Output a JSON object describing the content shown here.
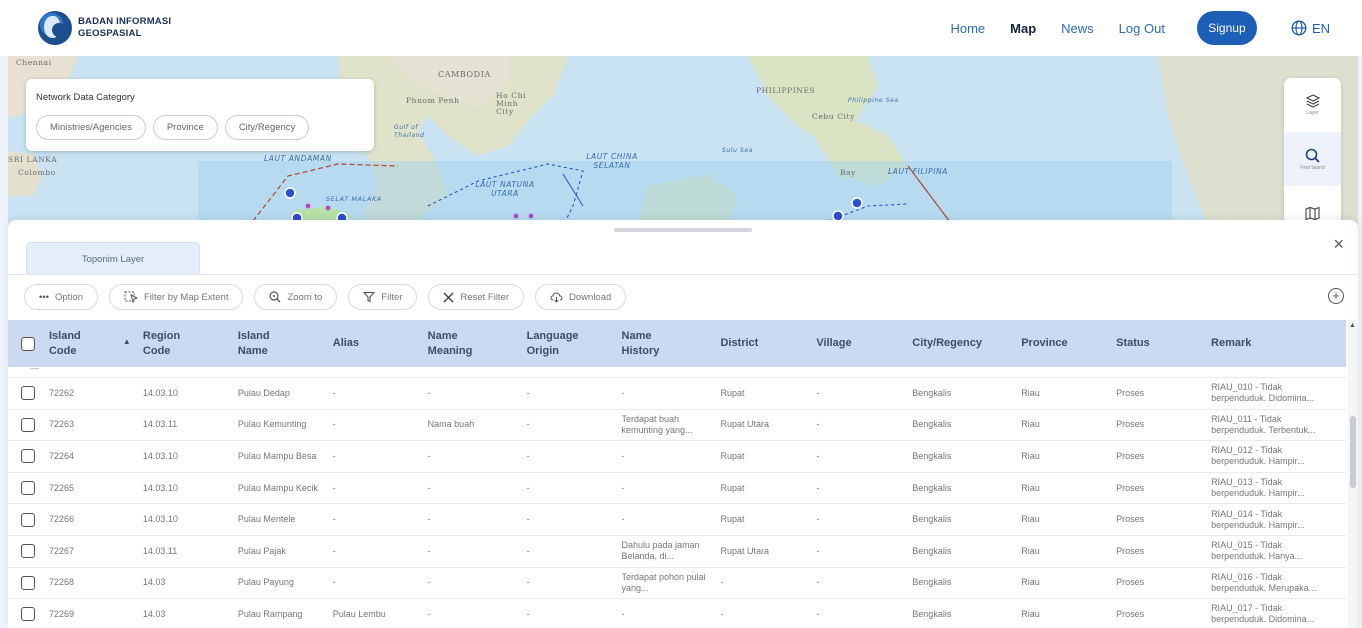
{
  "brand": {
    "line1": "BADAN INFORMASI",
    "line2": "GEOSPASIAL"
  },
  "nav": {
    "home": "Home",
    "map": "Map",
    "news": "News",
    "logout": "Log Out",
    "signup": "Signup",
    "lang": "EN"
  },
  "map_labels": {
    "chennai": "Chennai",
    "cambodia": "CAMBODIA",
    "phnom_penh": "Phnom Penh",
    "ho_chi_minh": "Ho Chi Minh City",
    "philippines": "PHILIPPINES",
    "philippine_sea": "Philippine Sea",
    "cebu": "Cebu City",
    "gulf_thailand": "Gulf of Thailand",
    "sulu_sea": "Sulu Sea",
    "sri_lanka": "SRI LANKA",
    "colombo": "Colombo",
    "laut_andaman": "LAUT ANDAMAN",
    "laut_china_selatan": "LAUT CHINA SELATAN",
    "laut_natuna_utara": "LAUT NATUNA UTARA",
    "selat_malaka": "SELAT MALAKA",
    "bay": "Bay",
    "laut_filipina": "LAUT FILIPINA"
  },
  "category": {
    "title": "Network Data Category",
    "chips": [
      "Ministries/Agencies",
      "Province",
      "City/Regency"
    ]
  },
  "tools": {
    "layer": "Layer",
    "find": "Find Island"
  },
  "panel": {
    "tab": "Toponim Layer",
    "toolbar": {
      "option": "Option",
      "filter_extent": "Filter by Map Extent",
      "zoom": "Zoom to",
      "filter": "Filter",
      "reset": "Reset Filter",
      "download": "Download"
    }
  },
  "table": {
    "headers": {
      "island_code": "Island Code",
      "region_code": "Region Code",
      "island_name": "Island Name",
      "alias": "Alias",
      "name_meaning": "Name Meaning",
      "language_origin": "Language Origin",
      "name_history": "Name History",
      "district": "District",
      "village": "Village",
      "city": "City/Regency",
      "province": "Province",
      "status": "Status",
      "remark": "Remark"
    },
    "rows": [
      {
        "island_code": "72262",
        "region_code": "14.03.10",
        "island_name": "Pulau Dedap",
        "alias": "-",
        "name_meaning": "-",
        "language_origin": "-",
        "name_history": "-",
        "district": "Rupat",
        "village": "-",
        "city": "Bengkalis",
        "province": "Riau",
        "status": "Proses",
        "remark": "RIAU_010 - Tidak berpenduduk. Didomina..."
      },
      {
        "island_code": "72263",
        "region_code": "14.03.11",
        "island_name": "Pulau Kemunting",
        "alias": "-",
        "name_meaning": "Nama buah",
        "language_origin": "-",
        "name_history": "Terdapat buah kemunting yang...",
        "district": "Rupat Utara",
        "village": "-",
        "city": "Bengkalis",
        "province": "Riau",
        "status": "Proses",
        "remark": "RIAU_011 - Tidak berpenduduk. Terbentuk..."
      },
      {
        "island_code": "72264",
        "region_code": "14.03.10",
        "island_name": "Pulau Mampu Besa",
        "alias": "-",
        "name_meaning": "-",
        "language_origin": "-",
        "name_history": "-",
        "district": "Rupat",
        "village": "-",
        "city": "Bengkalis",
        "province": "Riau",
        "status": "Proses",
        "remark": "RIAU_012 - Tidak berpenduduk. Hampir..."
      },
      {
        "island_code": "72265",
        "region_code": "14.03.10",
        "island_name": "Pulau Mampu Kecik",
        "alias": "-",
        "name_meaning": "-",
        "language_origin": "-",
        "name_history": "-",
        "district": "Rupat",
        "village": "-",
        "city": "Bengkalis",
        "province": "Riau",
        "status": "Proses",
        "remark": "RIAU_013 - Tidak berpenduduk. Hampir..."
      },
      {
        "island_code": "72266",
        "region_code": "14.03.10",
        "island_name": "Pulau Mentele",
        "alias": "-",
        "name_meaning": "-",
        "language_origin": "-",
        "name_history": "-",
        "district": "Rupat",
        "village": "-",
        "city": "Bengkalis",
        "province": "Riau",
        "status": "Proses",
        "remark": "RIAU_014 - Tidak berpenduduk. Hampir..."
      },
      {
        "island_code": "72267",
        "region_code": "14.03.11",
        "island_name": "Pulau Pajak",
        "alias": "-",
        "name_meaning": "-",
        "language_origin": "-",
        "name_history": "Dahulu pada jaman Belanda, di...",
        "district": "Rupat Utara",
        "village": "-",
        "city": "Bengkalis",
        "province": "Riau",
        "status": "Proses",
        "remark": "RIAU_015 - Tidak berpenduduk. Hanya..."
      },
      {
        "island_code": "72268",
        "region_code": "14.03",
        "island_name": "Pulau Payung",
        "alias": "-",
        "name_meaning": "-",
        "language_origin": "-",
        "name_history": "Terdapat pohon pulai yang...",
        "district": "-",
        "village": "-",
        "city": "Bengkalis",
        "province": "Riau",
        "status": "Proses",
        "remark": "RIAU_016 - Tidak berpenduduk. Merupaka..."
      },
      {
        "island_code": "72269",
        "region_code": "14.03",
        "island_name": "Pulau Rampang",
        "alias": "Pulau Lembu",
        "name_meaning": "-",
        "language_origin": "-",
        "name_history": "-",
        "district": "-",
        "village": "-",
        "city": "Bengkalis",
        "province": "Riau",
        "status": "Proses",
        "remark": "RIAU_017 - Tidak berpenduduk. Didomina..."
      }
    ]
  }
}
